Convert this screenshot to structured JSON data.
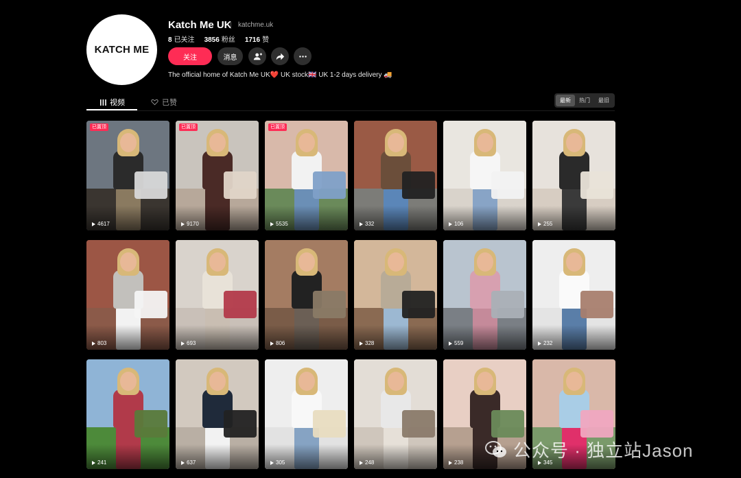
{
  "profile": {
    "avatar_text": "KATCH ME",
    "name": "Katch Me UK",
    "handle": "katchme.uk",
    "following_count": "8",
    "following_label": "已关注",
    "followers_count": "3856",
    "followers_label": "粉丝",
    "likes_count": "1716",
    "likes_label": "赞",
    "bio": "The official home of Katch Me UK❤️ UK stock🇬🇧 UK 1-2 days delivery 🚚"
  },
  "actions": {
    "follow_label": "关注",
    "message_label": "消息",
    "add_friend_icon": "person-add-icon",
    "share_icon": "share-arrow-icon",
    "more_icon": "more-dots-icon"
  },
  "tabs": {
    "videos_label": "视频",
    "liked_label": "已赞"
  },
  "sort": {
    "options": [
      "最新",
      "热门",
      "最旧"
    ],
    "selected": "最新"
  },
  "colors": {
    "accent": "#fe2c55",
    "background": "#000000",
    "button_dark": "#2f2f2f"
  },
  "videos": [
    {
      "views": "4617",
      "pinned": true,
      "pin_label": "已置顶"
    },
    {
      "views": "9170",
      "pinned": true,
      "pin_label": "已置顶"
    },
    {
      "views": "5535",
      "pinned": true,
      "pin_label": "已置顶"
    },
    {
      "views": "332"
    },
    {
      "views": "106"
    },
    {
      "views": "255"
    },
    {
      "views": "803"
    },
    {
      "views": "693"
    },
    {
      "views": "806"
    },
    {
      "views": "328"
    },
    {
      "views": "559"
    },
    {
      "views": "232"
    },
    {
      "views": "241"
    },
    {
      "views": "637"
    },
    {
      "views": "305"
    },
    {
      "views": "248"
    },
    {
      "views": "238"
    },
    {
      "views": "345"
    }
  ],
  "watermark": {
    "text": "公众号 · 独立站Jason",
    "icon": "wechat-icon"
  }
}
